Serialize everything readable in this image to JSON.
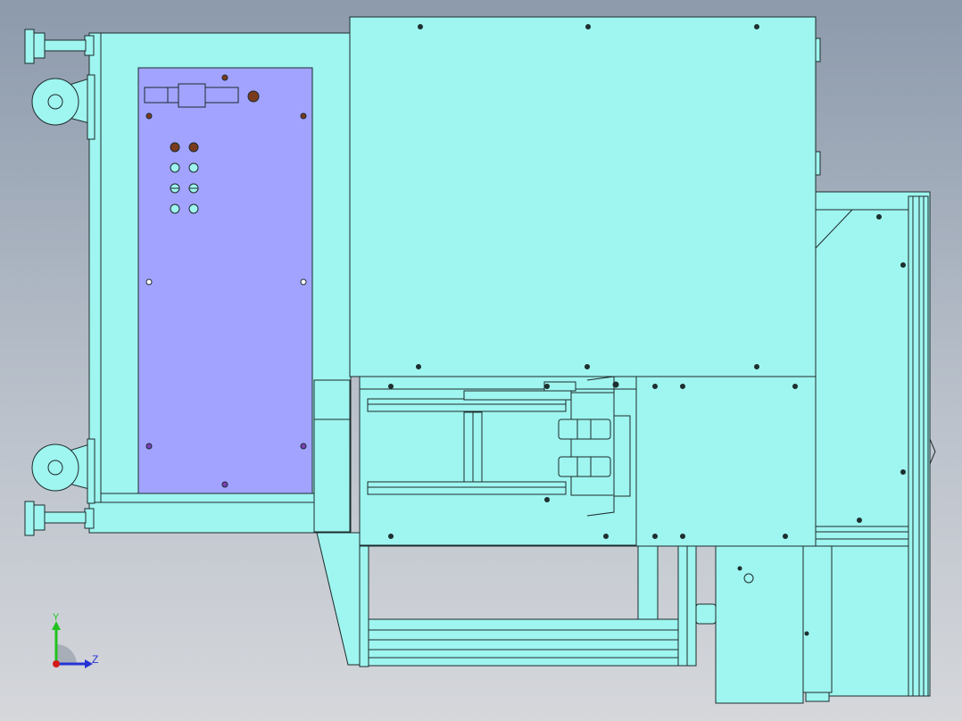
{
  "viewport": {
    "background_top": "#8c9aac",
    "background_bottom": "#d5d7db"
  },
  "model": {
    "body_color": "#9ff5ef",
    "panel_color": "#a2a3ff",
    "edge_color": "#1c2b2c",
    "hole_color": "#1f3030",
    "accent_hole_color": "#7a3b1d",
    "purple_hole_color": "#7d3fb8"
  },
  "triad": {
    "y_label": "Y",
    "z_label": "Z",
    "y_color": "#21c21e",
    "z_color": "#2433d6",
    "x_color": "#d31a1a"
  }
}
